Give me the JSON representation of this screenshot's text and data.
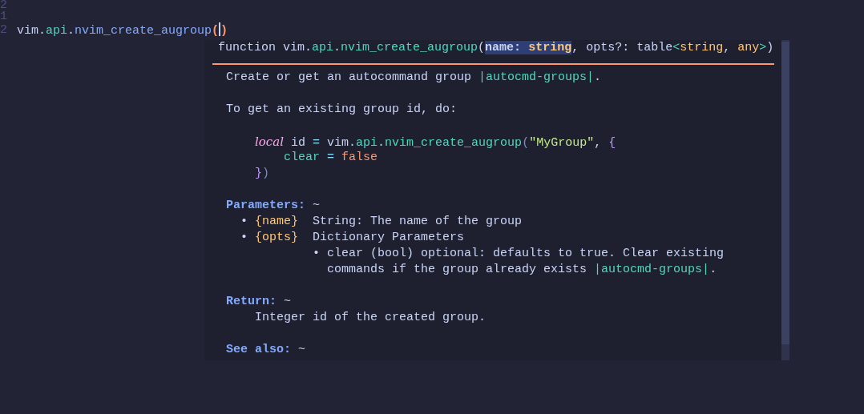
{
  "editor": {
    "line_numbers": [
      "2",
      "1",
      "2"
    ],
    "current_line": [
      {
        "t": "vim",
        "kind": "plain"
      },
      {
        "t": ".",
        "kind": "plain"
      },
      {
        "t": "api",
        "kind": "field"
      },
      {
        "t": ".",
        "kind": "plain"
      },
      {
        "t": "nvim_create_augroup",
        "kind": "func"
      },
      {
        "t": "(",
        "kind": "match"
      },
      {
        "t": ")",
        "kind": "match"
      }
    ]
  },
  "hover": {
    "signature": [
      {
        "t": "function vim.",
        "kind": "plain"
      },
      {
        "t": "api",
        "kind": "field"
      },
      {
        "t": ".",
        "kind": "plain"
      },
      {
        "t": "nvim_create_augroup",
        "kind": "field"
      },
      {
        "t": "(",
        "kind": "plain"
      },
      {
        "t": "name: ",
        "kind": "active"
      },
      {
        "t": "string",
        "kind": "active-type"
      },
      {
        "t": ", opts?: table",
        "kind": "plain"
      },
      {
        "t": "<",
        "kind": "field"
      },
      {
        "t": "string",
        "kind": "type"
      },
      {
        "t": ", ",
        "kind": "plain"
      },
      {
        "t": "any",
        "kind": "type"
      },
      {
        "t": ">",
        "kind": "field"
      },
      {
        "t": ")",
        "kind": "plain"
      }
    ],
    "blocks": [
      [
        [
          {
            "t": "Create or get an autocommand group ",
            "kind": "plain"
          },
          {
            "t": "|autocmd-groups|",
            "kind": "link"
          },
          {
            "t": ".",
            "kind": "plain"
          }
        ]
      ],
      [
        [
          {
            "t": "To get an existing group id, do:",
            "kind": "plain"
          }
        ]
      ],
      [
        [
          {
            "t": "    local",
            "kind": "keyword"
          },
          {
            "t": " id ",
            "kind": "plain"
          },
          {
            "t": "=",
            "kind": "op"
          },
          {
            "t": " vim",
            "kind": "plain"
          },
          {
            "t": ".",
            "kind": "op"
          },
          {
            "t": "api",
            "kind": "field"
          },
          {
            "t": ".",
            "kind": "op"
          },
          {
            "t": "nvim_create_augroup",
            "kind": "field"
          },
          {
            "t": "(",
            "kind": "dim"
          },
          {
            "t": "\"MyGroup\"",
            "kind": "string"
          },
          {
            "t": ", ",
            "kind": "plain"
          },
          {
            "t": "{",
            "kind": "bracket"
          }
        ],
        [
          {
            "t": "        clear",
            "kind": "field"
          },
          {
            "t": " = ",
            "kind": "op"
          },
          {
            "t": "false",
            "kind": "bool"
          }
        ],
        [
          {
            "t": "    }",
            "kind": "bracket"
          },
          {
            "t": ")",
            "kind": "dim"
          }
        ]
      ],
      [
        [
          {
            "t": "Parameters:",
            "kind": "header"
          },
          {
            "t": " ~",
            "kind": "plain"
          }
        ],
        [
          {
            "t": "  • ",
            "kind": "plain"
          },
          {
            "t": "{name}",
            "kind": "arg"
          },
          {
            "t": "  String: The name of the group",
            "kind": "plain"
          }
        ],
        [
          {
            "t": "  • ",
            "kind": "plain"
          },
          {
            "t": "{opts}",
            "kind": "arg"
          },
          {
            "t": "  Dictionary Parameters",
            "kind": "plain"
          }
        ],
        [
          {
            "t": "            • clear (bool) optional: defaults to true. Clear existing",
            "kind": "plain"
          }
        ],
        [
          {
            "t": "              commands if the group already exists ",
            "kind": "plain"
          },
          {
            "t": "|autocmd-groups|",
            "kind": "link"
          },
          {
            "t": ".",
            "kind": "plain"
          }
        ]
      ],
      [
        [
          {
            "t": "Return:",
            "kind": "header"
          },
          {
            "t": " ~",
            "kind": "plain"
          }
        ],
        [
          {
            "t": "    Integer id of the created group.",
            "kind": "plain"
          }
        ]
      ],
      [
        [
          {
            "t": "See also:",
            "kind": "header"
          },
          {
            "t": " ~",
            "kind": "plain"
          }
        ]
      ]
    ]
  }
}
